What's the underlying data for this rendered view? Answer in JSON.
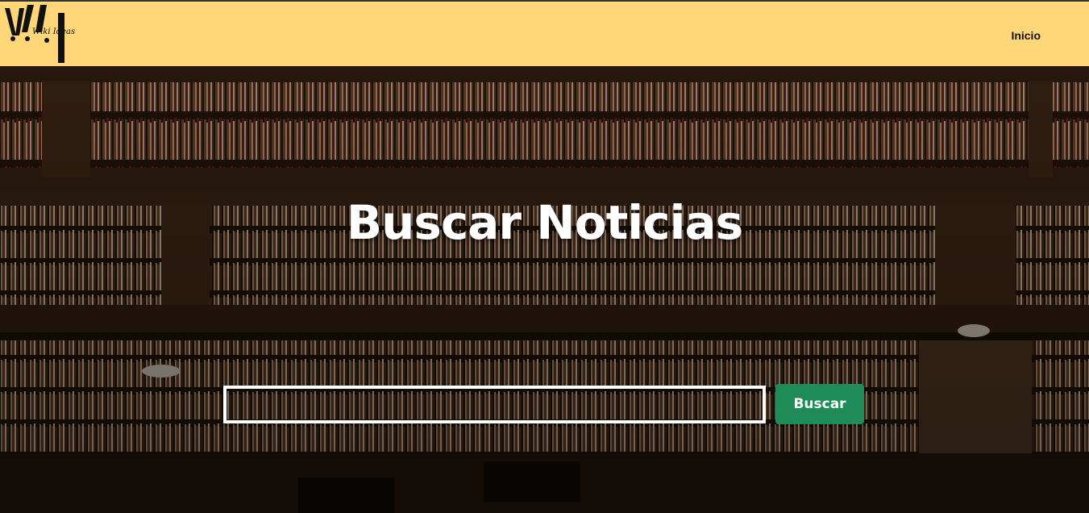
{
  "header": {
    "logo_text": "Wiki Ideas",
    "nav": {
      "inicio_label": "Inicio"
    }
  },
  "hero": {
    "title": "Buscar Noticias",
    "search": {
      "value": "",
      "placeholder": "",
      "button_label": "Buscar"
    }
  },
  "colors": {
    "header_bg": "#ffd778",
    "button_bg": "#1f8b57",
    "hero_text": "#ffffff"
  },
  "icons": [
    "wiki-ideas-logo"
  ]
}
